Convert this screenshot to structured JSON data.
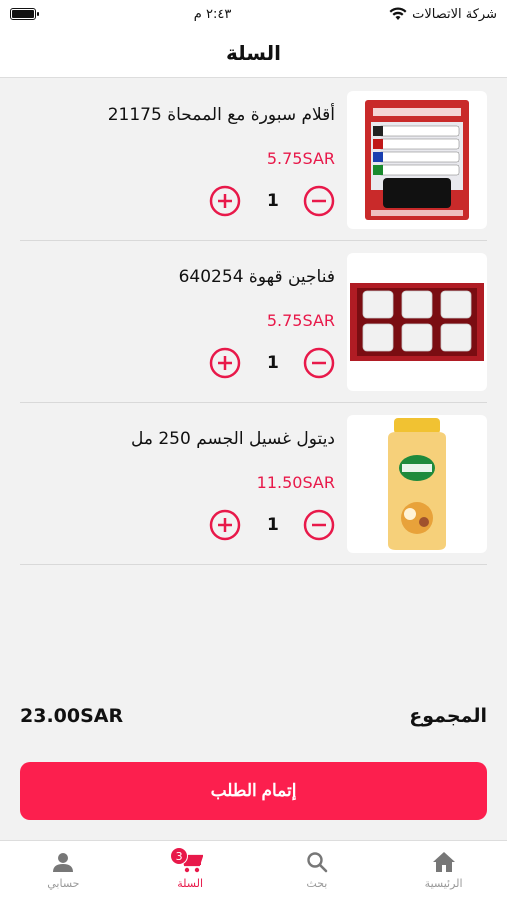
{
  "status_bar": {
    "carrier": "شركة الاتصالات",
    "time": "٢:٤٣ م"
  },
  "header": {
    "title": "السلة"
  },
  "cart": {
    "items": [
      {
        "name": "أقلام سبورة مع الممحاة 21175",
        "price": "5.75SAR",
        "quantity": "1"
      },
      {
        "name": "فناجين قهوة 640254",
        "price": "5.75SAR",
        "quantity": "1"
      },
      {
        "name": "ديتول غسيل الجسم 250 مل",
        "price": "11.50SAR",
        "quantity": "1"
      }
    ],
    "total_label": "المجموع",
    "total_amount": "23.00SAR",
    "checkout_label": "إتمام الطلب"
  },
  "tabbar": {
    "account": "حسابي",
    "cart": "السلة",
    "cart_badge": "3",
    "search": "بحث",
    "home": "الرئيسية"
  },
  "colors": {
    "accent": "#fc1f4e",
    "background": "#f2f2f2"
  }
}
